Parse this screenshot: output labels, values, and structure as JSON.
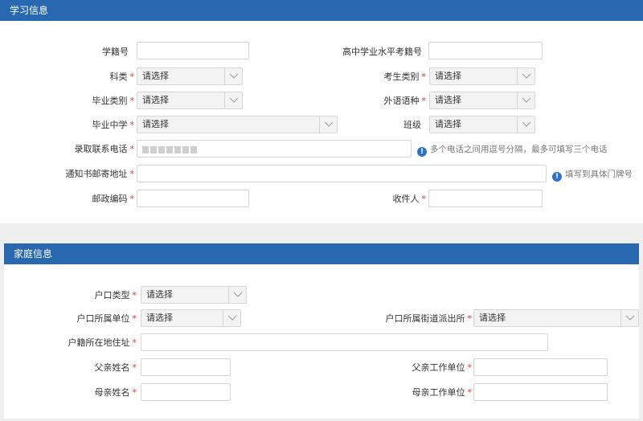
{
  "study": {
    "header": "学习信息",
    "fields": {
      "student_id": {
        "label": "学籍号",
        "value": ""
      },
      "hs_exam_id": {
        "label": "高中学业水平考籍号",
        "value": ""
      },
      "subject_type": {
        "label": "科类",
        "value": "请选择"
      },
      "exam_category": {
        "label": "考生类别",
        "value": "请选择"
      },
      "grad_category": {
        "label": "毕业类别",
        "value": "请选择"
      },
      "language": {
        "label": "外语语种",
        "value": "请选择"
      },
      "grad_school": {
        "label": "毕业中学",
        "value": "请选择"
      },
      "class": {
        "label": "班级",
        "value": "请选择"
      },
      "phone": {
        "label": "录取联系电话",
        "value": ""
      },
      "phone_hint": "多个电话之间用逗号分隔，最多可填写三个电话",
      "address": {
        "label": "通知书邮寄地址",
        "value": ""
      },
      "address_hint": "填写到具体门牌号",
      "postcode": {
        "label": "邮政编码",
        "value": ""
      },
      "recipient": {
        "label": "收件人",
        "value": ""
      }
    }
  },
  "family": {
    "header": "家庭信息",
    "fields": {
      "hukou_type": {
        "label": "户口类型",
        "value": "请选择"
      },
      "hukou_unit": {
        "label": "户口所属单位",
        "value": "请选择"
      },
      "hukou_station": {
        "label": "户口所属街道派出所",
        "value": "请选择"
      },
      "hukou_address": {
        "label": "户籍所在地住址",
        "value": ""
      },
      "father_name": {
        "label": "父亲姓名",
        "value": ""
      },
      "father_work": {
        "label": "父亲工作单位",
        "value": ""
      },
      "mother_name": {
        "label": "母亲姓名",
        "value": ""
      },
      "mother_work": {
        "label": "母亲工作单位",
        "value": ""
      }
    }
  },
  "required_mark": "*",
  "colors": {
    "header_bg": "#2868b0",
    "required": "#e53935",
    "hint_icon": "#2f73c8"
  }
}
